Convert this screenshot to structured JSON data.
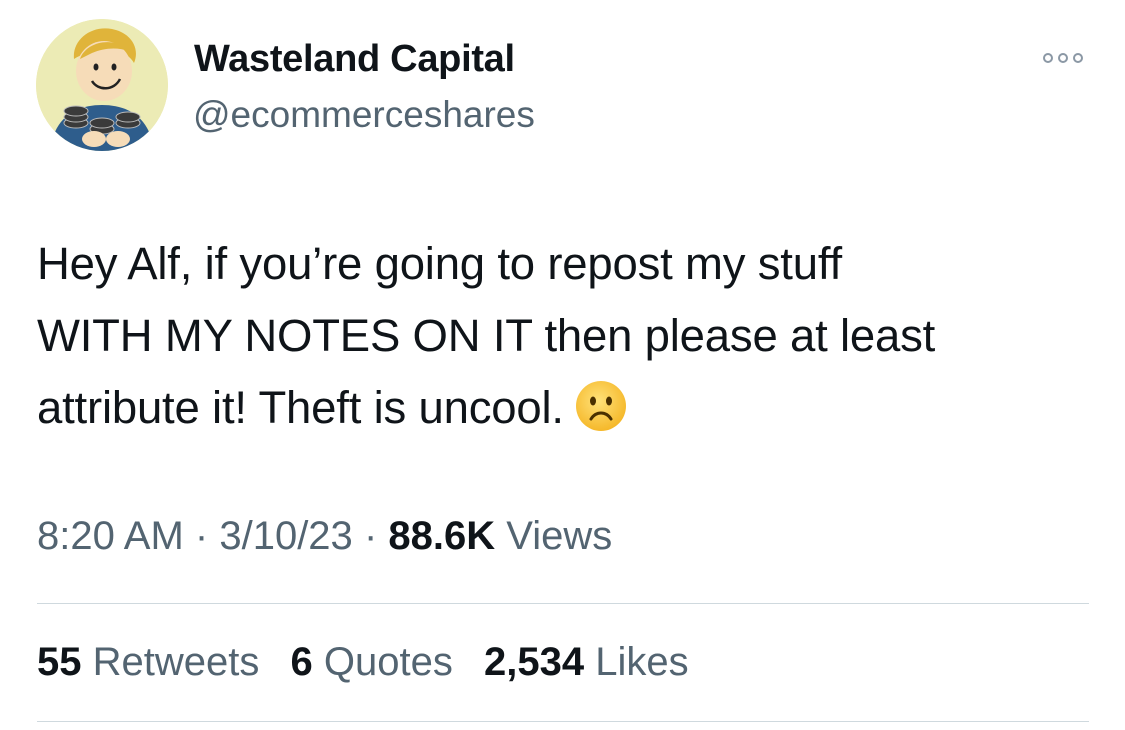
{
  "author": {
    "display_name": "Wasteland Capital",
    "handle": "@ecommerceshares",
    "avatar_icon": "vault-boy-avatar-icon"
  },
  "menu": {
    "more_icon": "more-horizontal-icon"
  },
  "tweet": {
    "lines": [
      "Hey Alf, if you’re going to repost my stuff",
      "WITH MY NOTES ON IT then please at least",
      "attribute it! Theft is uncool."
    ],
    "emoji_icon": "frowning-face-emoji-icon"
  },
  "meta": {
    "time": "8:20 AM",
    "separator": "·",
    "date": "3/10/23",
    "views_count": "88.6K",
    "views_label": "Views"
  },
  "stats": {
    "retweets_count": "55",
    "retweets_label": "Retweets",
    "quotes_count": "6",
    "quotes_label": "Quotes",
    "likes_count": "2,534",
    "likes_label": "Likes"
  },
  "colors": {
    "primary_text": "#0f1419",
    "secondary_text": "#536471",
    "divider": "#cfd9de"
  }
}
